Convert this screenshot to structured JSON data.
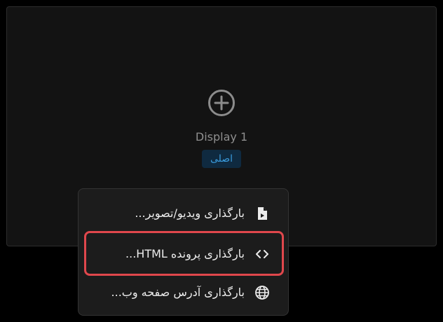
{
  "display": {
    "name": "Display 1",
    "badge": "اصلی",
    "add_icon": "plus-circle-icon"
  },
  "menu": {
    "items": [
      {
        "label": "بارگذاری ویدیو/تصویر...",
        "icon": "file-icon"
      },
      {
        "label": "بارگذاری پرونده HTML...",
        "icon": "code-icon",
        "highlighted": true
      },
      {
        "label": "بارگذاری آدرس صفحه وب...",
        "icon": "globe-icon"
      }
    ]
  },
  "colors": {
    "highlight": "#e0474c",
    "badge_text": "#3a9bdc",
    "badge_bg": "#0f2a40"
  }
}
